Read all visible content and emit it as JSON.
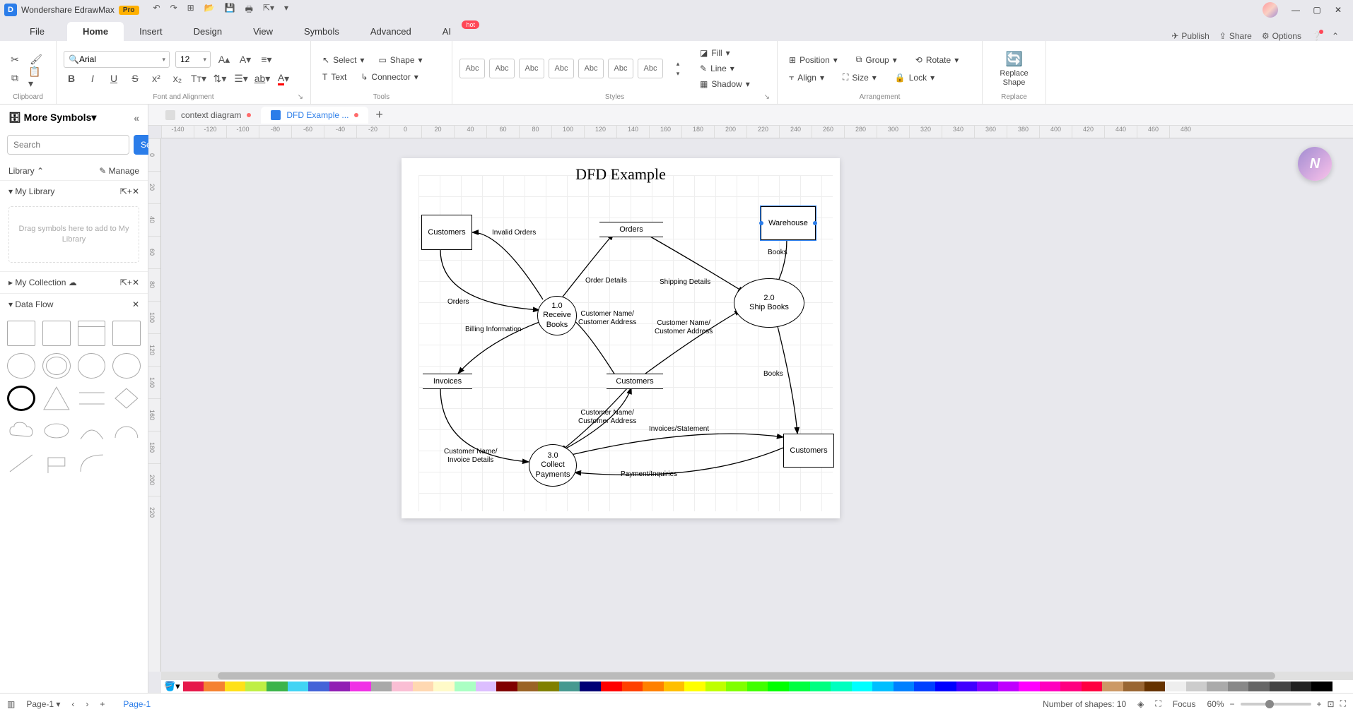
{
  "app": {
    "title": "Wondershare EdrawMax",
    "pro": "Pro"
  },
  "menu": {
    "file": "File",
    "tabs": [
      "Home",
      "Insert",
      "Design",
      "View",
      "Symbols",
      "Advanced",
      "AI"
    ],
    "active": "Home",
    "hot": "hot",
    "right": {
      "publish": "Publish",
      "share": "Share",
      "options": "Options"
    }
  },
  "ribbon": {
    "clipboard": {
      "label": "Clipboard"
    },
    "font": {
      "family": "Arial",
      "size": "12",
      "label": "Font and Alignment"
    },
    "tools": {
      "select": "Select",
      "shape": "Shape",
      "text": "Text",
      "connector": "Connector",
      "label": "Tools"
    },
    "styles": {
      "sample": "Abc",
      "label": "Styles",
      "fill": "Fill",
      "line": "Line",
      "shadow": "Shadow"
    },
    "arrange": {
      "position": "Position",
      "align": "Align",
      "group": "Group",
      "size": "Size",
      "rotate": "Rotate",
      "lock": "Lock",
      "label": "Arrangement"
    },
    "replace": {
      "btn": "Replace Shape",
      "label": "Replace"
    }
  },
  "doctabs": {
    "tabs": [
      {
        "name": "context diagram",
        "active": false,
        "dirty": true
      },
      {
        "name": "DFD Example ...",
        "active": true,
        "dirty": true
      }
    ]
  },
  "left": {
    "header": "More Symbols",
    "search_placeholder": "Search",
    "search_btn": "Search",
    "library": "Library",
    "manage": "Manage",
    "mylib": "My Library",
    "drop": "Drag symbols here to add to My Library",
    "mycoll": "My Collection",
    "dataflow": "Data Flow"
  },
  "ruler_h": [
    "-140",
    "-120",
    "-100",
    "-80",
    "-60",
    "-40",
    "-20",
    "0",
    "20",
    "40",
    "60",
    "80",
    "100",
    "120",
    "140",
    "160",
    "180",
    "200",
    "220",
    "240",
    "260",
    "280",
    "300",
    "320",
    "340",
    "360",
    "380",
    "400",
    "420",
    "440",
    "460",
    "480"
  ],
  "ruler_v": [
    "0",
    "20",
    "40",
    "60",
    "80",
    "100",
    "120",
    "140",
    "160",
    "180",
    "200",
    "220"
  ],
  "diagram": {
    "title": "DFD Example",
    "entities": {
      "cust1": "Customers",
      "warehouse": "Warehouse",
      "cust2": "Customers"
    },
    "stores": {
      "orders": "Orders",
      "invoices": "Invoices",
      "customers": "Customers"
    },
    "processes": {
      "p1": {
        "id": "1.0",
        "name": "Receive Books"
      },
      "p2": {
        "id": "2.0",
        "name": "Ship Books"
      },
      "p3": {
        "id": "3.0",
        "name": "Collect Payments"
      }
    },
    "flows": {
      "invalid_orders": "Invalid Orders",
      "orders": "Orders",
      "order_details": "Order Details",
      "shipping_details": "Shipping Details",
      "cust_name_addr": "Customer Name/\nCustomer Address",
      "billing_info": "Billing Information",
      "books1": "Books",
      "books2": "Books",
      "invoices_stmt": "Invoices/Statement",
      "payment_inq": "Payment/Inquiries",
      "cust_name_inv": "Customer Name/\nInvoice Details"
    }
  },
  "status": {
    "page_dropdown": "Page-1",
    "page_tab": "Page-1",
    "shapes": "Number of shapes: 10",
    "focus": "Focus",
    "zoom": "60%"
  },
  "colors": [
    "#e6194b",
    "#f58231",
    "#ffe119",
    "#bfef45",
    "#3cb44b",
    "#42d4f4",
    "#4363d8",
    "#911eb4",
    "#f032e6",
    "#a9a9a9",
    "#fabed4",
    "#ffd8b1",
    "#fffac8",
    "#aaffc3",
    "#dcbeff",
    "#800000",
    "#9a6324",
    "#808000",
    "#469990",
    "#000075",
    "#ff0000",
    "#ff4000",
    "#ff8000",
    "#ffbf00",
    "#ffff00",
    "#bfff00",
    "#80ff00",
    "#40ff00",
    "#00ff00",
    "#00ff40",
    "#00ff80",
    "#00ffbf",
    "#00ffff",
    "#00bfff",
    "#0080ff",
    "#0040ff",
    "#0000ff",
    "#4000ff",
    "#8000ff",
    "#bf00ff",
    "#ff00ff",
    "#ff00bf",
    "#ff0080",
    "#ff0040",
    "#cc9966",
    "#996633",
    "#663300",
    "#eeeeee",
    "#cccccc",
    "#aaaaaa",
    "#888888",
    "#666666",
    "#444444",
    "#222222",
    "#000000",
    "#ffffff"
  ]
}
